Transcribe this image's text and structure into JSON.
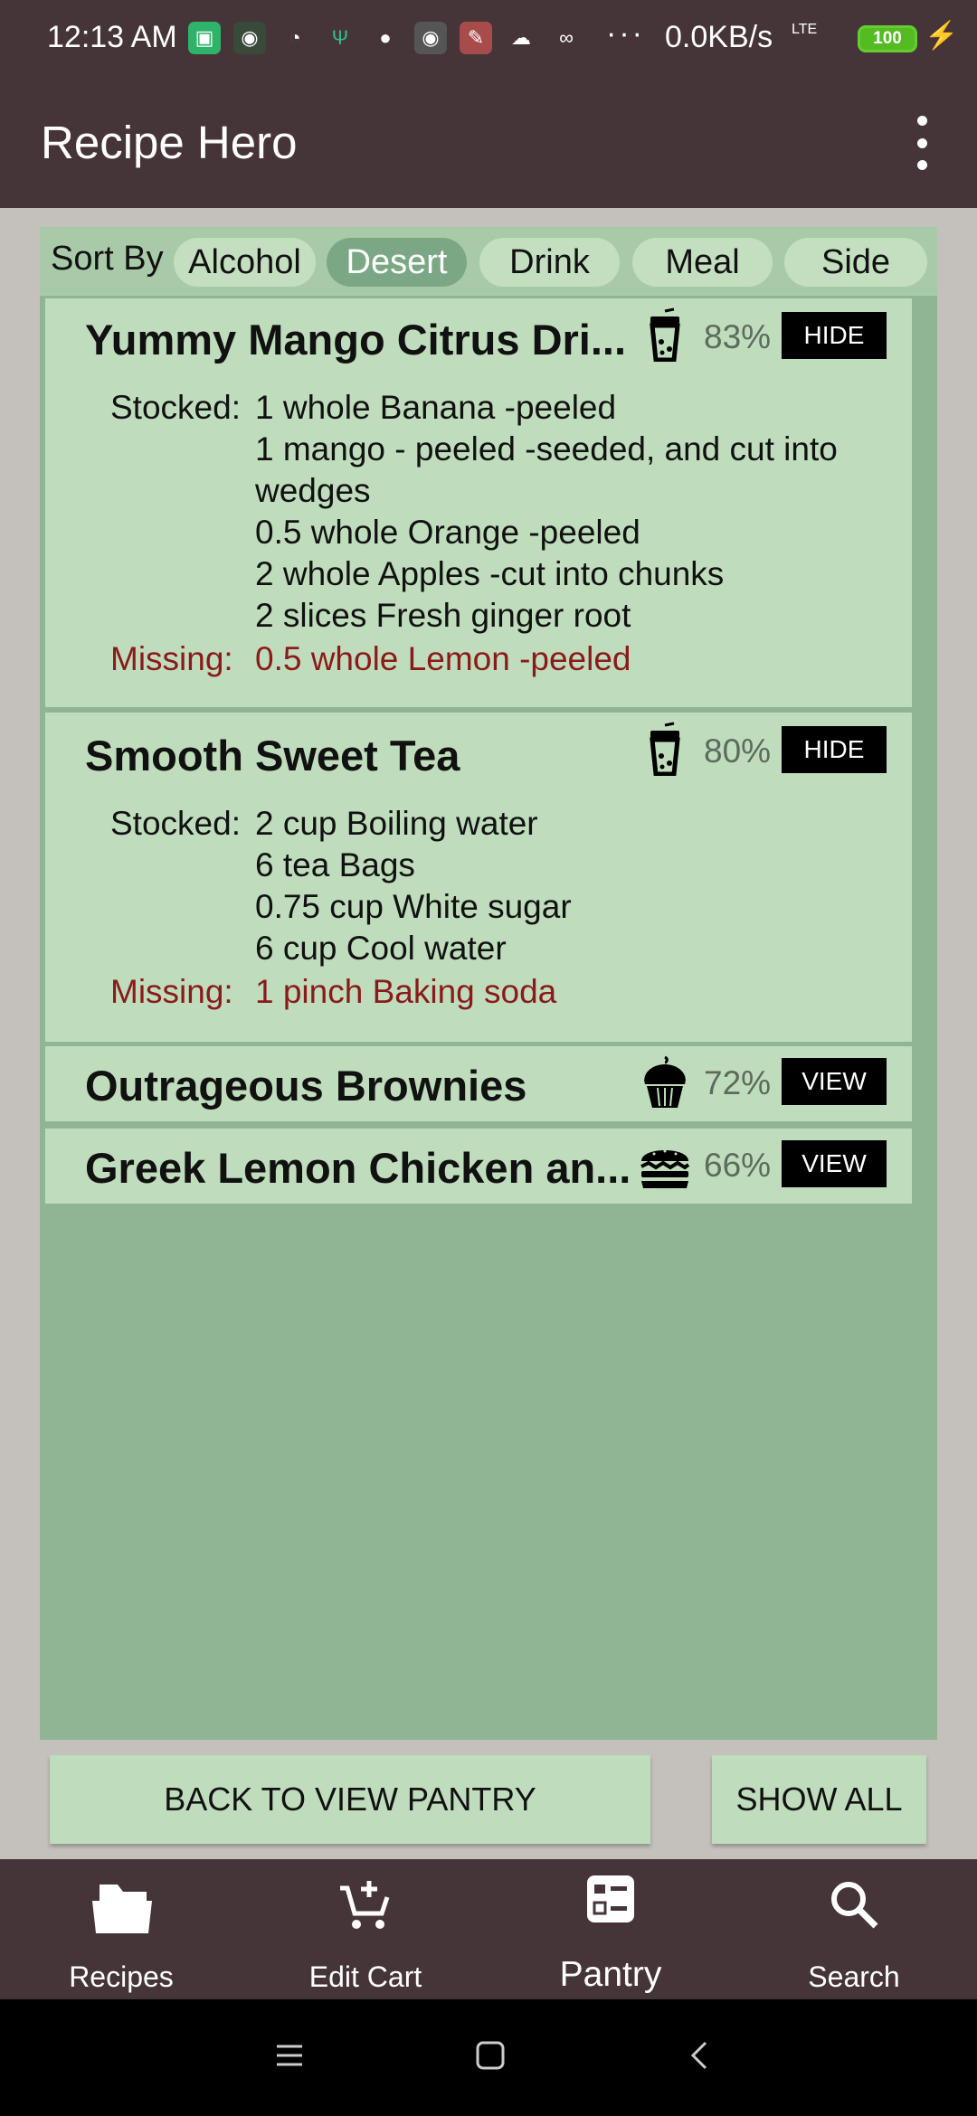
{
  "status": {
    "time": "12:13 AM",
    "net_speed": "0.0KB/s",
    "dots": "···",
    "signal": "LTE",
    "battery": "100"
  },
  "app": {
    "title": "Recipe Hero"
  },
  "sort": {
    "label": "Sort By",
    "chips": [
      "Alcohol",
      "Desert",
      "Drink",
      "Meal",
      "Side"
    ],
    "active": "Desert"
  },
  "recipes": [
    {
      "title": "Yummy Mango Citrus Dri...",
      "icon": "drink-icon",
      "percent": "83%",
      "button": "HIDE",
      "stocked_label": "Stocked:",
      "stocked": [
        "1 whole Banana -peeled",
        "1 mango - peeled -seeded, and cut into wedges",
        "0.5 whole Orange -peeled",
        "2 whole Apples -cut into chunks",
        "2 slices Fresh ginger root"
      ],
      "missing_label": "Missing:",
      "missing": [
        "0.5 whole Lemon -peeled"
      ]
    },
    {
      "title": "Smooth Sweet Tea",
      "icon": "drink-icon",
      "percent": "80%",
      "button": "HIDE",
      "stocked_label": "Stocked:",
      "stocked": [
        "2 cup Boiling water",
        "6 tea Bags",
        "0.75 cup White sugar",
        "6 cup Cool water"
      ],
      "missing_label": "Missing:",
      "missing": [
        "1 pinch Baking soda"
      ]
    },
    {
      "title": "Outrageous Brownies",
      "icon": "cupcake-icon",
      "percent": "72%",
      "button": "VIEW"
    },
    {
      "title": "Greek Lemon Chicken an...",
      "icon": "burger-icon",
      "percent": "66%",
      "button": "VIEW"
    }
  ],
  "actions": {
    "back": "BACK TO VIEW PANTRY",
    "show_all": "SHOW ALL"
  },
  "nav": [
    {
      "label": "Recipes",
      "icon": "folder-icon"
    },
    {
      "label": "Edit Cart",
      "icon": "cart-add-icon"
    },
    {
      "label": "Pantry",
      "icon": "pantry-icon",
      "active": true
    },
    {
      "label": "Search",
      "icon": "search-icon"
    }
  ],
  "colors": {
    "bar": "#463538",
    "panel": "#8fb595",
    "card": "#bfddbc",
    "missing": "#8b1a1a"
  }
}
